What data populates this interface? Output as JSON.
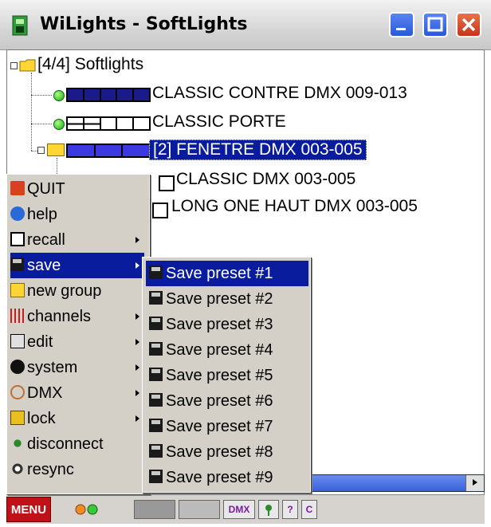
{
  "window": {
    "title": "WiLights - SoftLights"
  },
  "tree": {
    "root_label": "[4/4] Softlights",
    "items": [
      {
        "label": "CLASSIC CONTRE  DMX  009-013"
      },
      {
        "label": "CLASSIC PORTE"
      },
      {
        "label": "[2] FENETRE  DMX  003-005"
      },
      {
        "label": "CLASSIC  DMX  003-005"
      },
      {
        "label": "LONG ONE HAUT  DMX  003-005"
      }
    ]
  },
  "main_menu": {
    "items": [
      {
        "label": "QUIT",
        "icon": "power-icon"
      },
      {
        "label": "help",
        "icon": "info-icon"
      },
      {
        "label": "recall",
        "icon": "list-icon"
      },
      {
        "label": "save",
        "icon": "floppy-icon"
      },
      {
        "label": "new group",
        "icon": "new-folder-icon"
      },
      {
        "label": "channels",
        "icon": "sliders-icon"
      },
      {
        "label": "edit",
        "icon": "edit-icon"
      },
      {
        "label": "system",
        "icon": "wrench-icon"
      },
      {
        "label": "DMX",
        "icon": "dmx-icon"
      },
      {
        "label": "lock",
        "icon": "lock-icon"
      },
      {
        "label": "disconnect",
        "icon": "antenna-icon"
      },
      {
        "label": "resync",
        "icon": "gears-icon"
      }
    ]
  },
  "save_submenu": {
    "items": [
      "Save preset #1",
      "Save preset #2",
      "Save preset #3",
      "Save preset #4",
      "Save preset #5",
      "Save preset #6",
      "Save preset #7",
      "Save preset #8",
      "Save preset #9"
    ]
  },
  "statusbar": {
    "menu_label": "MENU",
    "dmx_label": "DMX",
    "help_label": "?",
    "c_label": "C"
  },
  "colors": {
    "selection": "#0a1c9e",
    "menu_bg": "#d4d0c8",
    "menu_button": "#c01018"
  }
}
